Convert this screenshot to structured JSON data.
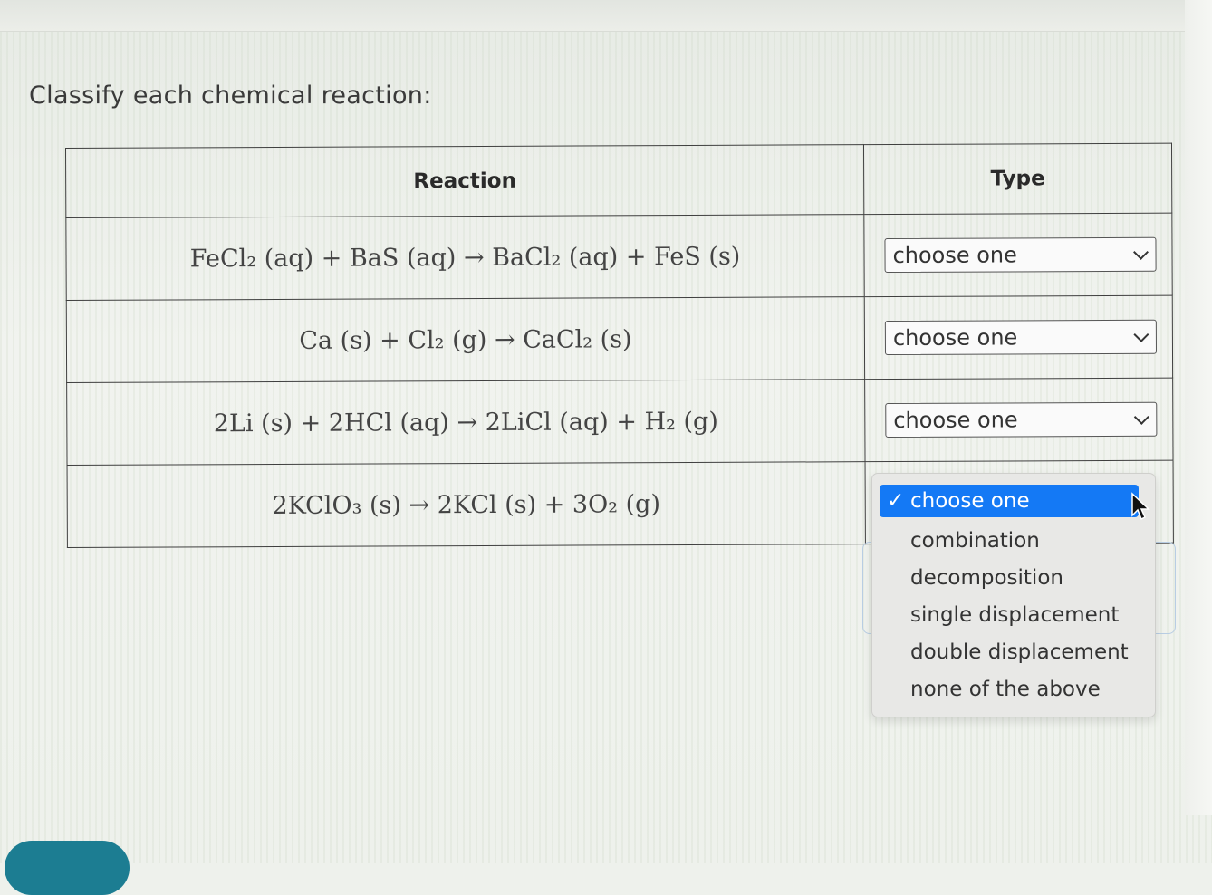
{
  "prompt": "Classify each chemical reaction:",
  "table": {
    "headers": {
      "reaction": "Reaction",
      "type": "Type"
    },
    "rows": [
      {
        "reaction": "FeCl₂ (aq) + BaS (aq) → BaCl₂ (aq) + FeS (s)",
        "type": "choose one"
      },
      {
        "reaction": "Ca (s) + Cl₂ (g) → CaCl₂ (s)",
        "type": "choose one"
      },
      {
        "reaction": "2Li (s) + 2HCl (aq) → 2LiCl (aq) + H₂ (g)",
        "type": "choose one"
      },
      {
        "reaction": "2KClO₃ (s) → 2KCl (s) + 3O₂ (g)",
        "type": "choose one"
      }
    ]
  },
  "dropdown": {
    "open_row": 4,
    "check_mark": "✓",
    "options": [
      "choose one",
      "combination",
      "decomposition",
      "single displacement",
      "double displacement",
      "none of the above"
    ],
    "selected": "choose one",
    "highlight_color": "#1479f5"
  },
  "icons": [
    "chevron-down-icon",
    "checkmark-icon",
    "mouse-pointer-icon"
  ]
}
